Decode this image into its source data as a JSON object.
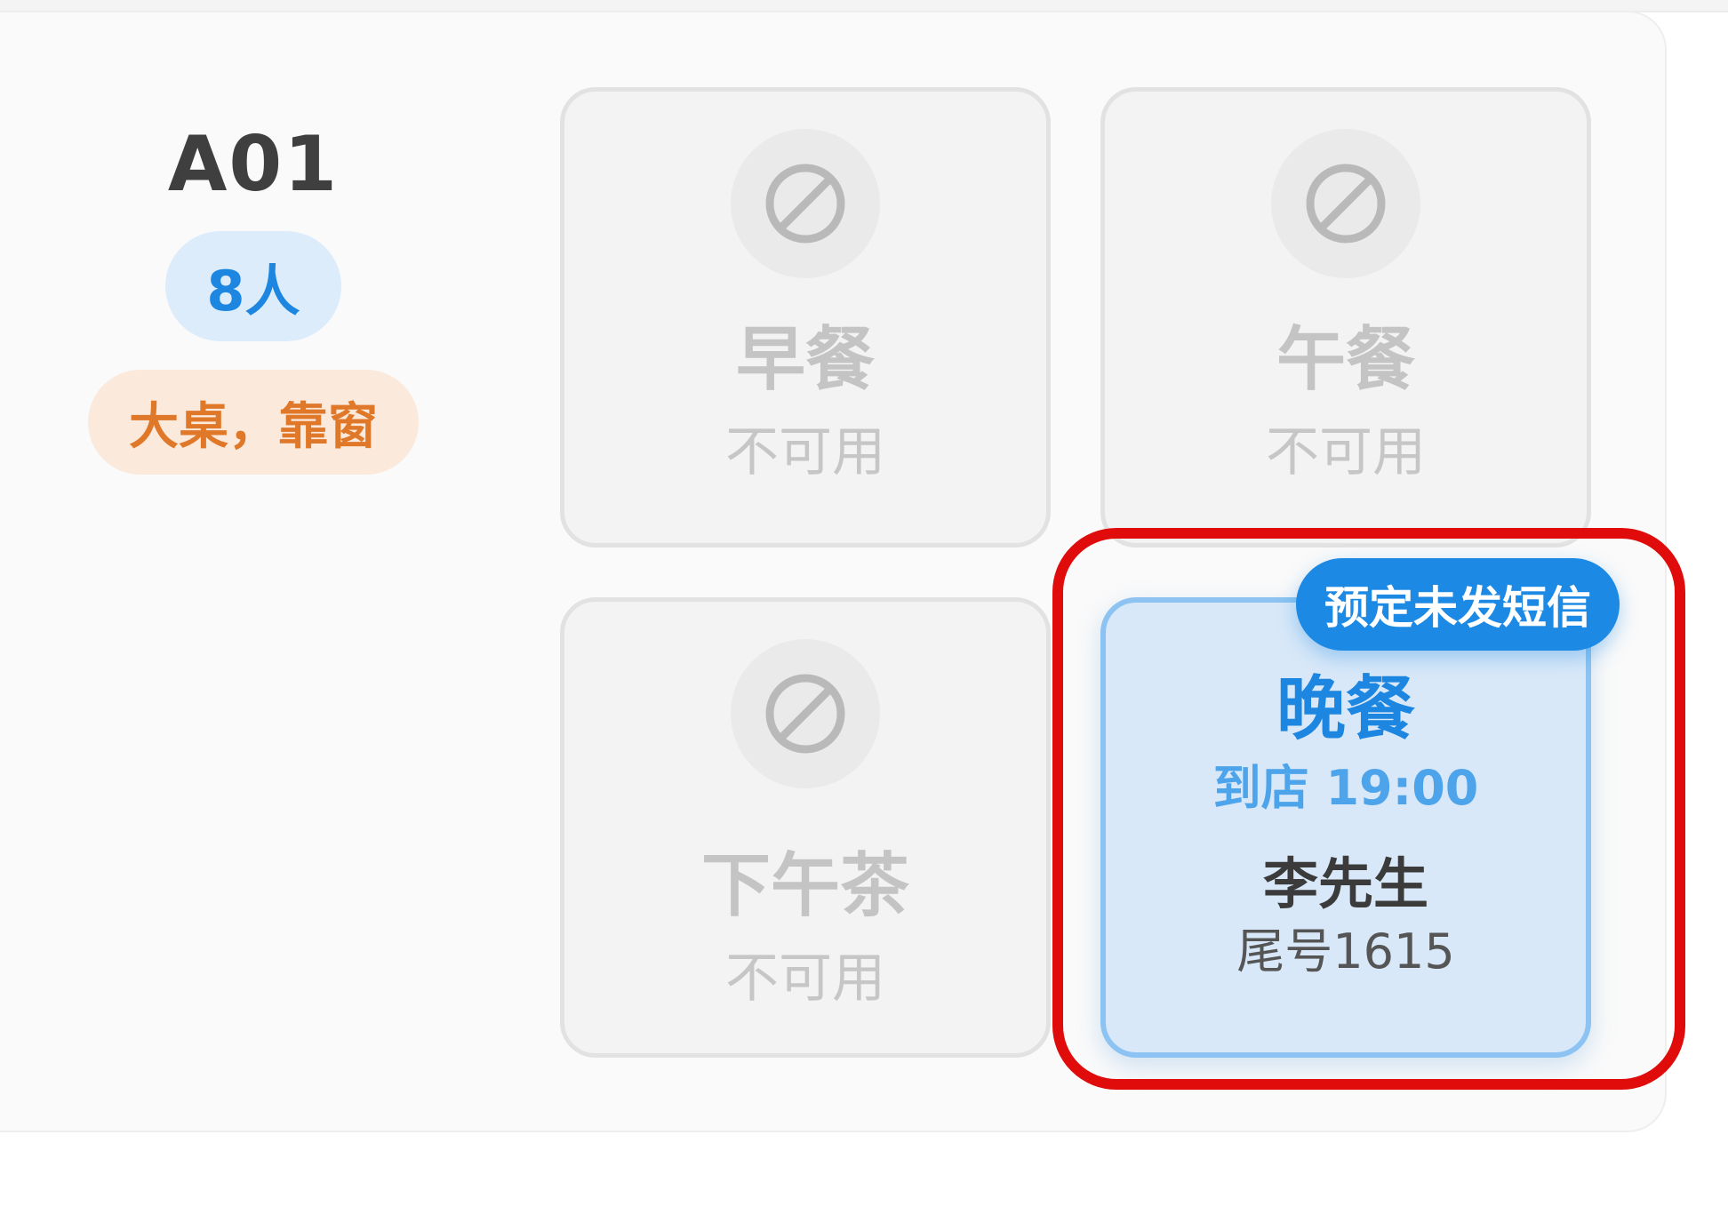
{
  "table": {
    "id": "A01",
    "capacity": "8人",
    "features": "大桌，靠窗"
  },
  "slots": {
    "breakfast": {
      "name": "早餐",
      "status": "不可用"
    },
    "lunch": {
      "name": "午餐",
      "status": "不可用"
    },
    "afternoon_tea": {
      "name": "下午茶",
      "status": "不可用"
    },
    "dinner": {
      "name": "晚餐",
      "arrival": "到店 19:00",
      "guest": "李先生",
      "phone_tail": "尾号1615",
      "tag": "预定未发短信"
    }
  },
  "icons": {
    "unavailable": "ban-icon"
  },
  "colors": {
    "primary_blue": "#1c86e0",
    "badge_orange": "#e0782a",
    "highlight_red": "#e00b0b",
    "disabled_gray": "#c4c4c4"
  }
}
